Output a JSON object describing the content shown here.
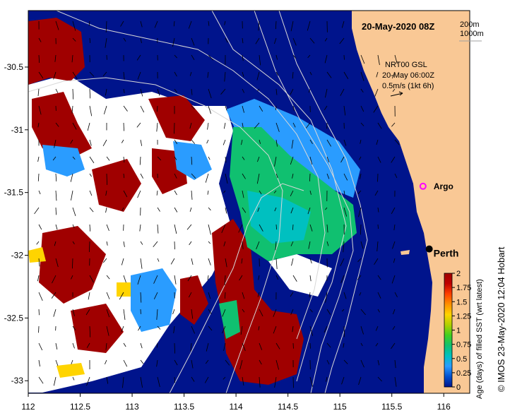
{
  "map": {
    "title": "20-May-2020 08Z",
    "depth_legend": [
      "200m",
      "1000m"
    ],
    "current_info": [
      "NRT00 GSL",
      "20-May 06:00Z",
      "0.5m/s (1kt 6h)"
    ],
    "extent": {
      "lon": [
        112,
        116.25
      ],
      "lat": [
        -33.1,
        -30.05
      ]
    },
    "lon_ticks": [
      "112",
      "112.5",
      "113",
      "113.5",
      "114",
      "114.5",
      "115",
      "115.5",
      "116"
    ],
    "lat_ticks": [
      "-30.5",
      "-31",
      "-31.5",
      "-32",
      "-32.5",
      "-33"
    ],
    "places": [
      {
        "name": "Perth",
        "lon": 115.86,
        "lat": -31.95,
        "icon": "black-dot"
      },
      {
        "name": "Argo",
        "lon": 115.8,
        "lat": -31.45,
        "icon": "magenta-circle"
      }
    ],
    "colors": {
      "land": "#f9c895",
      "ocean_old": "#00148c",
      "missing": "#ffffff",
      "cloud_old": "#a00000",
      "bathymetry": "#d8d8d8"
    }
  },
  "colorbar": {
    "label": "Age (days) of filled SST (wrt latest)",
    "ticks": [
      "2",
      "1.75",
      "1.5",
      "1.25",
      "1",
      "0.75",
      "0.5",
      "0.25",
      "0"
    ],
    "range": [
      0,
      2
    ],
    "colors": [
      "#00148c",
      "#0050d0",
      "#2a9cff",
      "#00c0c0",
      "#10c070",
      "#40d020",
      "#b0d000",
      "#ffd400",
      "#ff9000",
      "#ff4000",
      "#c00000",
      "#a00000"
    ]
  },
  "credit": "© IMOS 23-May-2020 12:04 Hobart"
}
